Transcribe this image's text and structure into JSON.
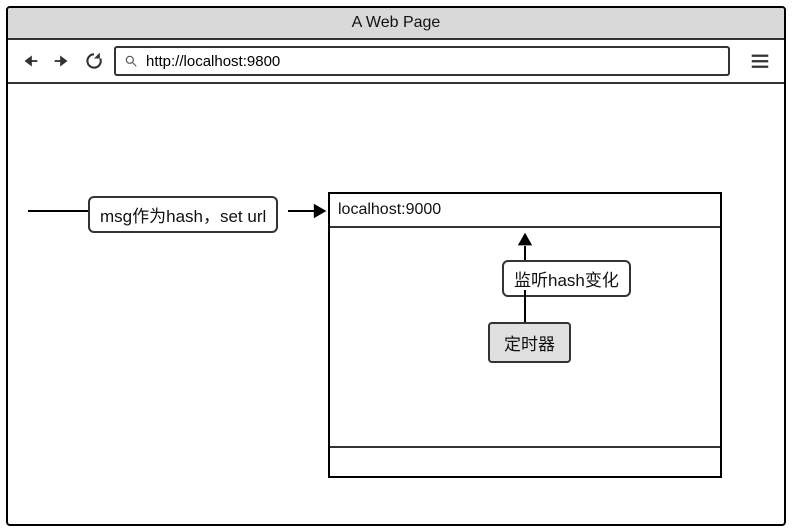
{
  "window": {
    "title": "A Web Page"
  },
  "address_bar": {
    "url": "http://localhost:9800"
  },
  "diagram": {
    "msg_label": "msg作为hash，set url",
    "iframe_url": "localhost:9000",
    "listen_label": "监听hash变化",
    "timer_label": "定时器"
  }
}
